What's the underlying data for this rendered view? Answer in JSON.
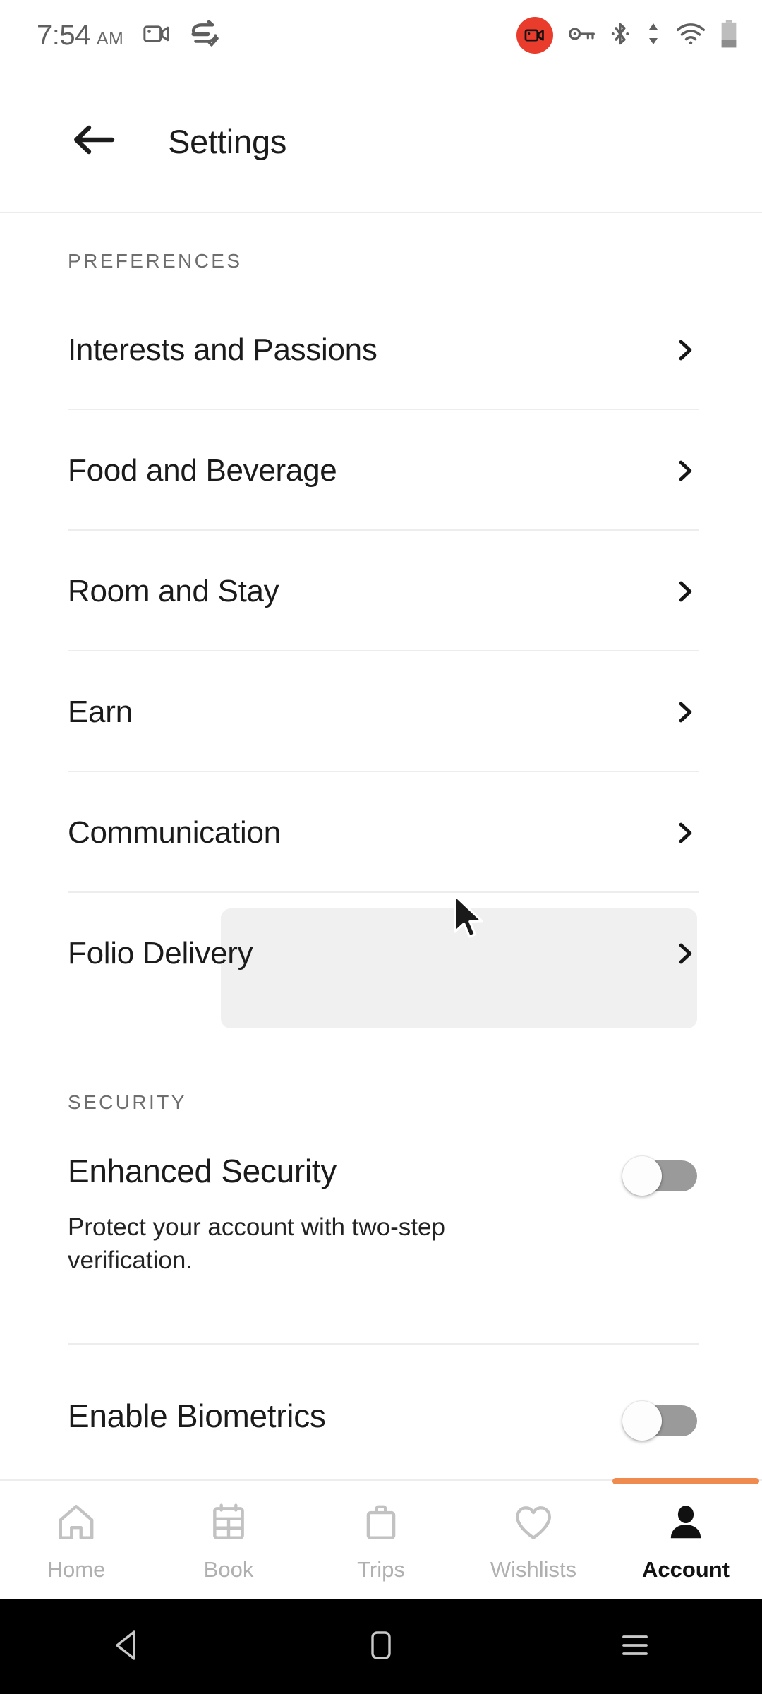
{
  "status_bar": {
    "time": "7:54",
    "am_pm": "AM",
    "left_icons": [
      "screen-record-icon",
      "data-saver-check-icon"
    ],
    "right_icons": [
      "screen-recording-active-icon",
      "vpn-key-icon",
      "bluetooth-icon",
      "data-transfer-icon",
      "wifi-icon",
      "battery-icon"
    ],
    "recording_badge_color": "#ea3c2d"
  },
  "header": {
    "back_icon": "arrow-left-icon",
    "title": "Settings"
  },
  "preferences": {
    "section_label": "PREFERENCES",
    "items": [
      {
        "label": "Interests and Passions",
        "chevron": "chevron-right-icon",
        "highlighted": false
      },
      {
        "label": "Food and Beverage",
        "chevron": "chevron-right-icon",
        "highlighted": false
      },
      {
        "label": "Room and Stay",
        "chevron": "chevron-right-icon",
        "highlighted": false
      },
      {
        "label": "Earn",
        "chevron": "chevron-right-icon",
        "highlighted": false
      },
      {
        "label": "Communication",
        "chevron": "chevron-right-icon",
        "highlighted": false
      },
      {
        "label": "Folio Delivery",
        "chevron": "chevron-right-icon",
        "highlighted": true
      }
    ]
  },
  "security": {
    "section_label": "SECURITY",
    "items": [
      {
        "title": "Enhanced Security",
        "subtitle": "Protect your account with two-step verification.",
        "toggle_state": "off"
      },
      {
        "title": "Enable Biometrics",
        "subtitle": "",
        "toggle_state": "off"
      }
    ]
  },
  "bottom_nav": {
    "active_indicator_color": "#f08b4f",
    "items": [
      {
        "label": "Home",
        "icon": "home-icon",
        "active": false
      },
      {
        "label": "Book",
        "icon": "calendar-icon",
        "active": false
      },
      {
        "label": "Trips",
        "icon": "briefcase-icon",
        "active": false
      },
      {
        "label": "Wishlists",
        "icon": "heart-icon",
        "active": false
      },
      {
        "label": "Account",
        "icon": "person-icon",
        "active": true
      }
    ]
  },
  "system_nav": {
    "buttons": [
      "back-triangle-icon",
      "home-square-icon",
      "recents-lines-icon"
    ]
  },
  "cursor": {
    "icon": "mouse-pointer-icon"
  }
}
